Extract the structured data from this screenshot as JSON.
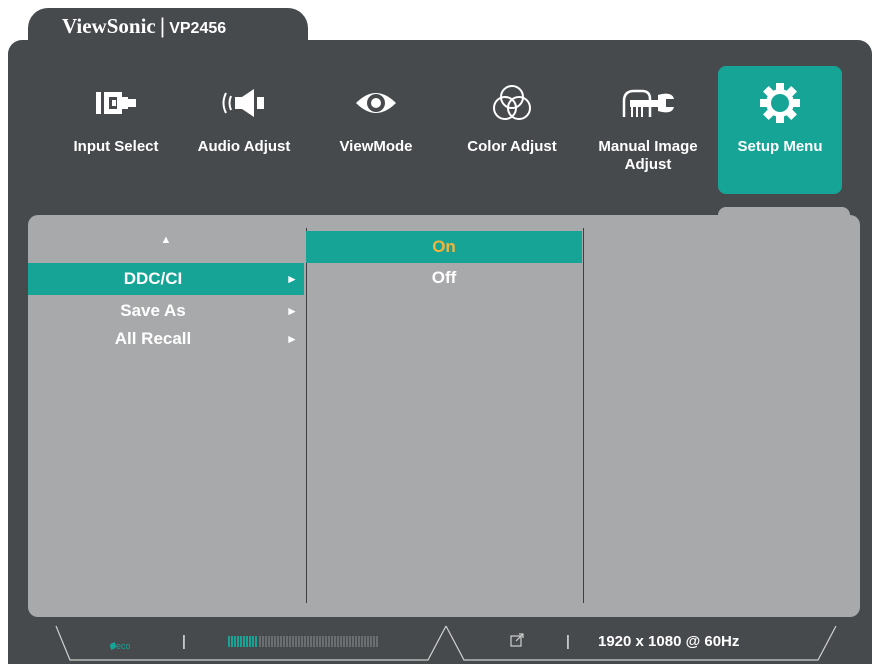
{
  "header": {
    "brand": "ViewSonic",
    "separator": "|",
    "model": "VP2456"
  },
  "menu": [
    {
      "label": "Input Select",
      "icon": "input-select-icon",
      "active": false
    },
    {
      "label": "Audio Adjust",
      "icon": "speaker-icon",
      "active": false
    },
    {
      "label": "ViewMode",
      "icon": "eye-icon",
      "active": false
    },
    {
      "label": "Color Adjust",
      "icon": "color-circles-icon",
      "active": false
    },
    {
      "label": "Manual Image Adjust",
      "icon": "hand-wrench-icon",
      "active": false
    },
    {
      "label": "Setup Menu",
      "icon": "gear-icon",
      "active": true
    }
  ],
  "submenu": {
    "up_arrow": "▲",
    "items": [
      {
        "label": "DDC/CI",
        "arrow": "►",
        "selected": true
      },
      {
        "label": "Save As",
        "arrow": "►",
        "selected": false
      },
      {
        "label": "All Recall",
        "arrow": "►",
        "selected": false
      }
    ]
  },
  "options": [
    {
      "label": "On",
      "selected": true
    },
    {
      "label": "Off",
      "selected": false
    }
  ],
  "status_bar": {
    "eco_text": "eco",
    "divider": "|",
    "resolution": "1920 x 1080 @ 60Hz",
    "link_icon": "external-link-icon"
  },
  "colors": {
    "accent": "#16a497",
    "selected_value": "#f4b43b",
    "frame": "#474a4d",
    "panel": "#a8a9ab"
  }
}
